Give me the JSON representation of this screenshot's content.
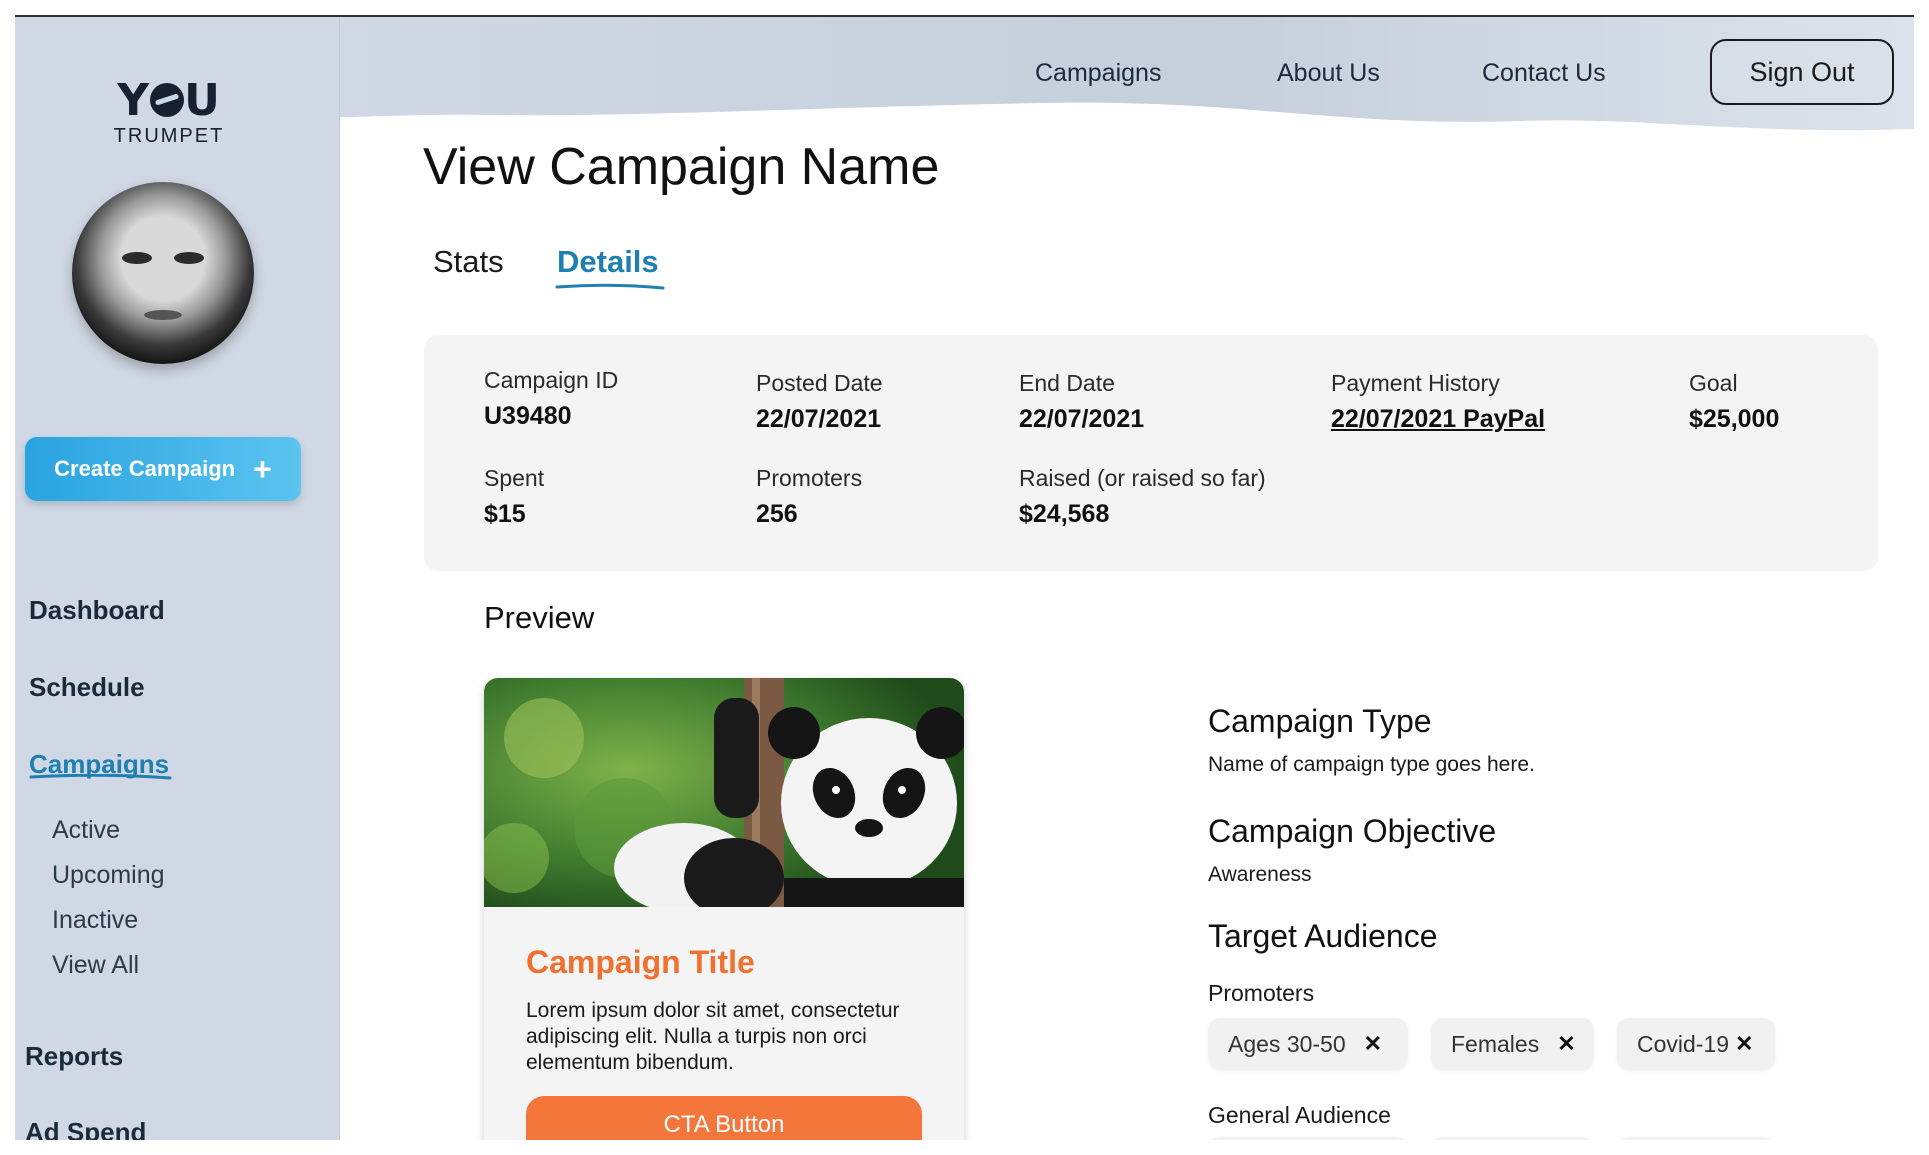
{
  "brand": {
    "logo_top": "Y",
    "logo_top_rest": "U",
    "logo_bottom": "TRUMPET"
  },
  "sidebar": {
    "create_label": "Create Campaign",
    "create_icon": "plus-icon",
    "items": [
      {
        "label": "Dashboard"
      },
      {
        "label": "Schedule"
      },
      {
        "label": "Campaigns",
        "active": true
      },
      {
        "label": "Reports"
      },
      {
        "label": "Ad Spend"
      }
    ],
    "sub_items": [
      {
        "label": "Active"
      },
      {
        "label": "Upcoming"
      },
      {
        "label": "Inactive"
      },
      {
        "label": "View All"
      }
    ]
  },
  "topnav": {
    "links": [
      "Campaigns",
      "About Us",
      "Contact Us"
    ],
    "signout": "Sign Out"
  },
  "page": {
    "title": "View Campaign Name",
    "tabs": [
      {
        "label": "Stats",
        "active": false
      },
      {
        "label": "Details",
        "active": true
      }
    ]
  },
  "info": {
    "campaign_id": {
      "label": "Campaign ID",
      "value": "U39480"
    },
    "posted_date": {
      "label": "Posted Date",
      "value": "22/07/2021"
    },
    "end_date": {
      "label": "End Date",
      "value": "22/07/2021"
    },
    "payment_history": {
      "label": "Payment History",
      "value": "22/07/2021 PayPal"
    },
    "goal": {
      "label": "Goal",
      "value": "$25,000"
    },
    "spent": {
      "label": "Spent",
      "value": "$15"
    },
    "promoters": {
      "label": "Promoters",
      "value": "256"
    },
    "raised": {
      "label": "Raised (or raised so far)",
      "value": "$24,568"
    }
  },
  "preview": {
    "label": "Preview",
    "card_title": "Campaign Title",
    "card_text": "Lorem ipsum dolor sit amet, consectetur adipiscing elit. Nulla a turpis non orci elementum bibendum.",
    "cta": "CTA Button"
  },
  "details": {
    "type_title": "Campaign Type",
    "type_text": "Name of campaign type goes here.",
    "objective_title": "Campaign Objective",
    "objective_text": "Awareness",
    "audience_title": "Target Audience",
    "promoters_label": "Promoters",
    "chips": [
      "Ages 30-50",
      "Females",
      "Covid-19"
    ],
    "chip_remove": "✕",
    "general_label": "General Audience"
  },
  "colors": {
    "accent": "#1f7fb0",
    "cta": "#f4763a",
    "sidebar": "#cfd8e4",
    "create": "#2aa3e0"
  }
}
